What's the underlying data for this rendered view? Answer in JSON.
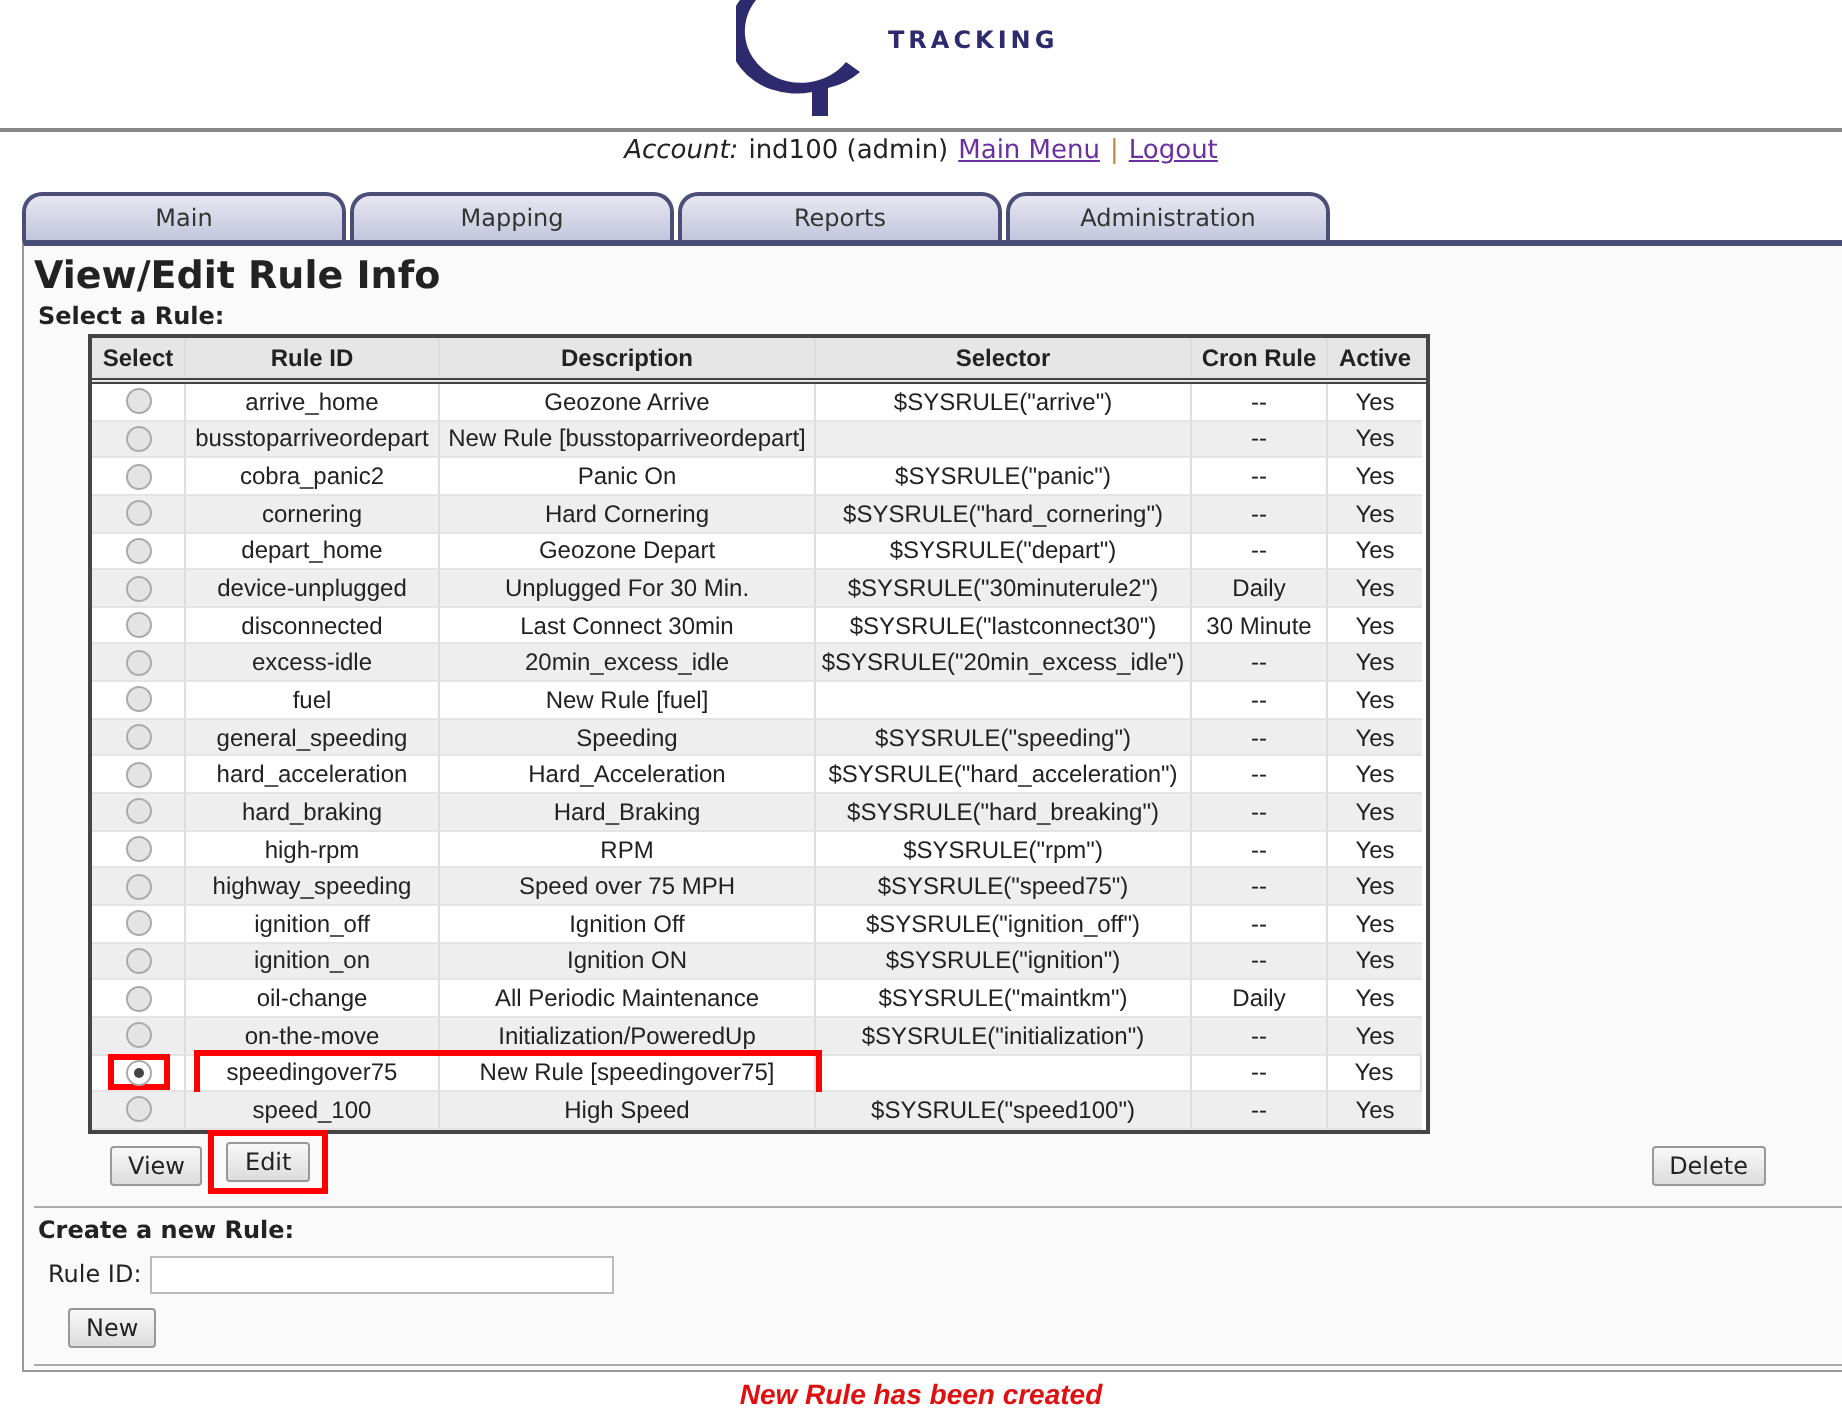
{
  "logo": {
    "tagline": "TRACKING"
  },
  "account": {
    "label": "Account:",
    "user": "ind100 (admin)",
    "links": [
      "Main Menu",
      "Logout"
    ],
    "separator": "|"
  },
  "tabs": [
    {
      "label": "Main",
      "selected": false
    },
    {
      "label": "Mapping",
      "selected": false
    },
    {
      "label": "Reports",
      "selected": false
    },
    {
      "label": "Administration",
      "selected": false
    }
  ],
  "title": "View/Edit Rule Info",
  "select_label": "Select a Rule:",
  "table": {
    "columns": [
      "Select",
      "Rule ID",
      "Description",
      "Selector",
      "Cron Rule",
      "Active"
    ],
    "rows": [
      {
        "selected": false,
        "highlighted": false,
        "rule_id": "arrive_home",
        "description": "Geozone Arrive",
        "selector": "$SYSRULE(\"arrive\")",
        "cron": "--",
        "active": "Yes"
      },
      {
        "selected": false,
        "highlighted": false,
        "rule_id": "busstoparriveordepart",
        "description": "New Rule [busstoparriveordepart]",
        "selector": "",
        "cron": "--",
        "active": "Yes"
      },
      {
        "selected": false,
        "highlighted": false,
        "rule_id": "cobra_panic2",
        "description": "Panic On",
        "selector": "$SYSRULE(\"panic\")",
        "cron": "--",
        "active": "Yes"
      },
      {
        "selected": false,
        "highlighted": false,
        "rule_id": "cornering",
        "description": "Hard Cornering",
        "selector": "$SYSRULE(\"hard_cornering\")",
        "cron": "--",
        "active": "Yes"
      },
      {
        "selected": false,
        "highlighted": false,
        "rule_id": "depart_home",
        "description": "Geozone Depart",
        "selector": "$SYSRULE(\"depart\")",
        "cron": "--",
        "active": "Yes"
      },
      {
        "selected": false,
        "highlighted": false,
        "rule_id": "device-unplugged",
        "description": "Unplugged For 30 Min.",
        "selector": "$SYSRULE(\"30minuterule2\")",
        "cron": "Daily",
        "active": "Yes"
      },
      {
        "selected": false,
        "highlighted": false,
        "rule_id": "disconnected",
        "description": "Last Connect 30min",
        "selector": "$SYSRULE(\"lastconnect30\")",
        "cron": "30 Minute",
        "active": "Yes"
      },
      {
        "selected": false,
        "highlighted": false,
        "rule_id": "excess-idle",
        "description": "20min_excess_idle",
        "selector": "$SYSRULE(\"20min_excess_idle\")",
        "cron": "--",
        "active": "Yes"
      },
      {
        "selected": false,
        "highlighted": false,
        "rule_id": "fuel",
        "description": "New Rule [fuel]",
        "selector": "",
        "cron": "--",
        "active": "Yes"
      },
      {
        "selected": false,
        "highlighted": false,
        "rule_id": "general_speeding",
        "description": "Speeding",
        "selector": "$SYSRULE(\"speeding\")",
        "cron": "--",
        "active": "Yes"
      },
      {
        "selected": false,
        "highlighted": false,
        "rule_id": "hard_acceleration",
        "description": "Hard_Acceleration",
        "selector": "$SYSRULE(\"hard_acceleration\")",
        "cron": "--",
        "active": "Yes"
      },
      {
        "selected": false,
        "highlighted": false,
        "rule_id": "hard_braking",
        "description": "Hard_Braking",
        "selector": "$SYSRULE(\"hard_breaking\")",
        "cron": "--",
        "active": "Yes"
      },
      {
        "selected": false,
        "highlighted": false,
        "rule_id": "high-rpm",
        "description": "RPM",
        "selector": "$SYSRULE(\"rpm\")",
        "cron": "--",
        "active": "Yes"
      },
      {
        "selected": false,
        "highlighted": false,
        "rule_id": "highway_speeding",
        "description": "Speed over 75 MPH",
        "selector": "$SYSRULE(\"speed75\")",
        "cron": "--",
        "active": "Yes"
      },
      {
        "selected": false,
        "highlighted": false,
        "rule_id": "ignition_off",
        "description": "Ignition Off",
        "selector": "$SYSRULE(\"ignition_off\")",
        "cron": "--",
        "active": "Yes"
      },
      {
        "selected": false,
        "highlighted": false,
        "rule_id": "ignition_on",
        "description": "Ignition ON",
        "selector": "$SYSRULE(\"ignition\")",
        "cron": "--",
        "active": "Yes"
      },
      {
        "selected": false,
        "highlighted": false,
        "rule_id": "oil-change",
        "description": "All Periodic Maintenance",
        "selector": "$SYSRULE(\"maintkm\")",
        "cron": "Daily",
        "active": "Yes"
      },
      {
        "selected": false,
        "highlighted": false,
        "rule_id": "on-the-move",
        "description": "Initialization/PoweredUp",
        "selector": "$SYSRULE(\"initialization\")",
        "cron": "--",
        "active": "Yes"
      },
      {
        "selected": true,
        "highlighted": true,
        "rule_id": "speedingover75",
        "description": "New Rule [speedingover75]",
        "selector": "",
        "cron": "--",
        "active": "Yes"
      },
      {
        "selected": false,
        "highlighted": false,
        "rule_id": "speed_100",
        "description": "High Speed",
        "selector": "$SYSRULE(\"speed100\")",
        "cron": "--",
        "active": "Yes"
      }
    ]
  },
  "actions": [
    {
      "label": "View",
      "highlighted": false
    },
    {
      "label": "Edit",
      "highlighted": true
    }
  ],
  "delete_button": "Delete",
  "create": {
    "heading": "Create a new Rule:",
    "field_label": "Rule ID:",
    "button": "New"
  },
  "message": "New Rule has been created"
}
